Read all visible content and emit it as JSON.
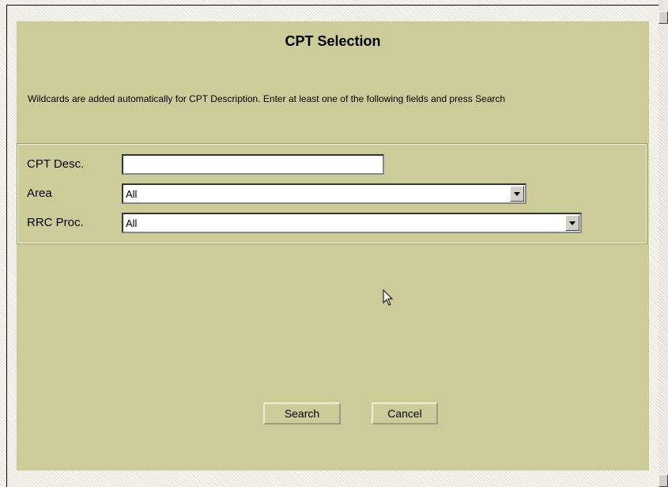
{
  "dialog": {
    "title": "CPT Selection",
    "instructions": "Wildcards are added automatically for CPT Description. Enter at least one of the following fields and press Search"
  },
  "form": {
    "cpt_desc_label": "CPT Desc.",
    "cpt_desc_value": "",
    "area_label": "Area",
    "area_value": "All",
    "rrc_proc_label": "RRC Proc.",
    "rrc_proc_value": "All"
  },
  "buttons": {
    "search": "Search",
    "cancel": "Cancel"
  },
  "icons": {
    "dropdown": "chevron-down-icon",
    "cursor": "mouse-pointer-icon"
  },
  "colors": {
    "panel": "#cccc99",
    "frame_highlight": "#f4f4e8"
  }
}
